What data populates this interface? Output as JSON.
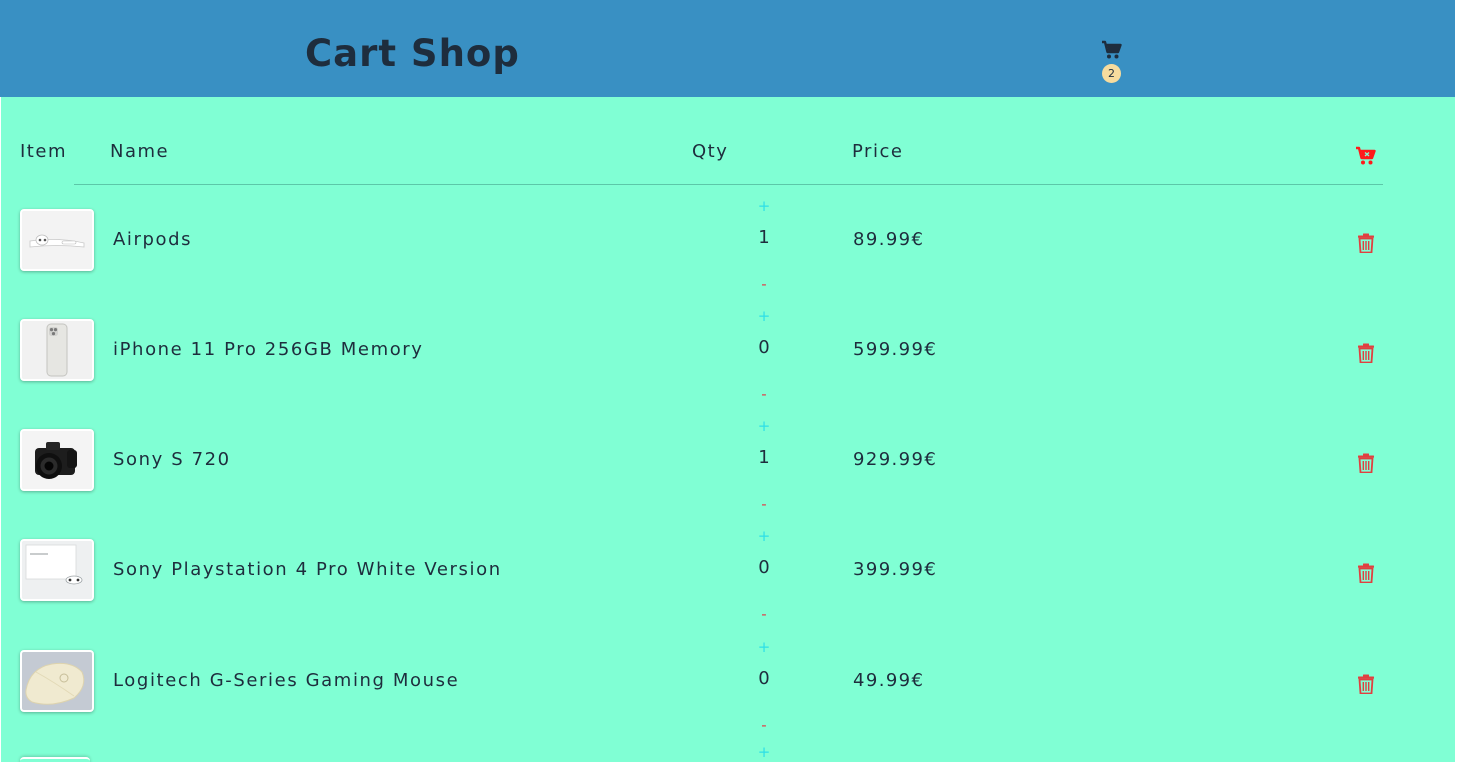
{
  "header": {
    "title": "Cart Shop",
    "cart_count": "2"
  },
  "table": {
    "headers": {
      "item": "Item",
      "name": "Name",
      "qty": "Qty",
      "price": "Price"
    },
    "qty_plus_label": "+",
    "qty_minus_label": "-",
    "rows": [
      {
        "name": "Airpods",
        "qty": "1",
        "price": "89.99€",
        "image_icon": "airpods-image"
      },
      {
        "name": "iPhone 11 Pro 256GB Memory",
        "qty": "0",
        "price": "599.99€",
        "image_icon": "iphone-image"
      },
      {
        "name": "Sony S 720",
        "qty": "1",
        "price": "929.99€",
        "image_icon": "camera-image"
      },
      {
        "name": "Sony Playstation 4 Pro White Version",
        "qty": "0",
        "price": "399.99€",
        "image_icon": "playstation-image"
      },
      {
        "name": "Logitech G-Series Gaming Mouse",
        "qty": "0",
        "price": "49.99€",
        "image_icon": "mouse-image"
      }
    ]
  },
  "colors": {
    "header_bg": "#3990c3",
    "content_bg": "#80ffd4",
    "plus": "#2ee0e6",
    "minus": "#e0404a",
    "trash": "#e04040",
    "clear_cart": "#ff1a1a",
    "badge_bg": "#f7dc9e"
  }
}
